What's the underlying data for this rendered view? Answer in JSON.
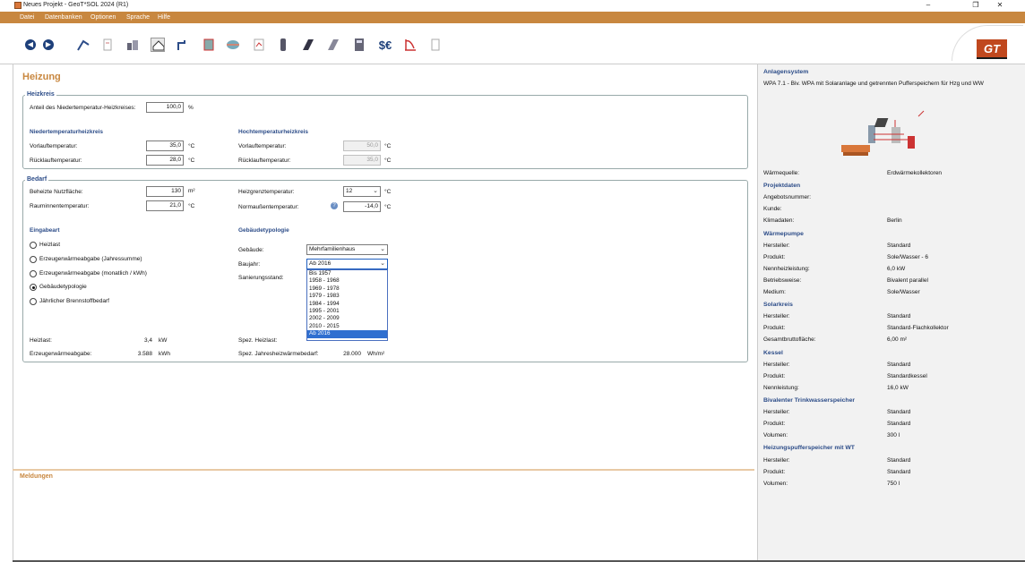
{
  "window": {
    "title": "Neues Projekt - GeoT*SOL 2024 (R1)",
    "minimize": "–",
    "restore": "❐",
    "close": "✕"
  },
  "menu": [
    "Datei",
    "Datenbanken",
    "Optionen",
    "Sprache",
    "Hilfe"
  ],
  "toolbar": {
    "back": "◀",
    "forward": "▶",
    "logo": "GT"
  },
  "page": {
    "title": "Heizung"
  },
  "heizkreis": {
    "legend": "Heizkreis",
    "anteil_label": "Anteil des Niedertemperatur-Heizkreises:",
    "anteil_value": "100,0",
    "anteil_unit": "%",
    "nt_title": "Niedertemperaturheizkreis",
    "ht_title": "Hochtemperaturheizkreis",
    "vorlauf_label": "Vorlauftemperatur:",
    "ruecklauf_label": "Rücklauftemperatur:",
    "nt_vorlauf": "35,0",
    "nt_ruecklauf": "28,0",
    "ht_vorlauf": "50,0",
    "ht_ruecklauf": "35,0",
    "unit_c": "°C"
  },
  "bedarf": {
    "legend": "Bedarf",
    "flaeche_label": "Beheizte Nutzfläche:",
    "flaeche_value": "130",
    "flaeche_unit": "m²",
    "raum_label": "Rauminnentemperatur:",
    "raum_value": "21,0",
    "heizgrenz_label": "Heizgrenztemperatur:",
    "heizgrenz_value": "12",
    "norm_label": "Normaußentemperatur:",
    "norm_value": "-14,0",
    "unit_c": "°C",
    "eingabeart_title": "Eingabeart",
    "eingabeart_options": [
      {
        "label": "Heizlast",
        "selected": false
      },
      {
        "label": "Erzeugerwärmeabgabe (Jahressumme)",
        "selected": false
      },
      {
        "label": "Erzeugerwärmeabgabe (monatlich / kWh)",
        "selected": false
      },
      {
        "label": "Gebäudetypologie",
        "selected": true
      },
      {
        "label": "Jährlicher Brennstoffbedarf",
        "selected": false
      }
    ],
    "typologie_title": "Gebäudetypologie",
    "gebaeude_label": "Gebäude:",
    "gebaeude_value": "Mehrfamilienhaus",
    "baujahr_label": "Baujahr:",
    "baujahr_value": "Ab 2016",
    "sanierung_label": "Sanierungsstand:",
    "baujahr_options": [
      "Bis 1957",
      "1958 - 1968",
      "1969 - 1978",
      "1979 - 1983",
      "1984 - 1994",
      "1995 - 2001",
      "2002 - 2009",
      "2010 - 2015",
      "Ab 2016"
    ],
    "heizlast_label": "Heizlast:",
    "heizlast_value": "3,4",
    "heizlast_unit": "kW",
    "erzeuger_label": "Erzeugerwärmeabgabe:",
    "erzeuger_value": "3.588",
    "erzeuger_unit": "kWh",
    "spez_heizlast_label": "Spez. Heizlast:",
    "spez_jahres_label": "Spez. Jahresheizwärmebedarf:",
    "spez_jahres_value": "28.000",
    "spez_jahres_unit": "Wh/m²"
  },
  "messages": {
    "title": "Meldungen"
  },
  "side": {
    "anlage_title": "Anlagensystem",
    "anlage_desc": "WPA 7.1 - Biv. WPA mit Solaranlage und getrennten Pufferspeichern für Hzg und WW",
    "rows_top": [
      {
        "k": "Wärmequelle:",
        "v": "Erdwärmekollektoren"
      }
    ],
    "sections": [
      {
        "title": "Projektdaten",
        "rows": [
          {
            "k": "Angebotsnummer:",
            "v": ""
          },
          {
            "k": "Kunde:",
            "v": ""
          },
          {
            "k": "Klimadaten:",
            "v": "Berlin"
          }
        ]
      },
      {
        "title": "Wärmepumpe",
        "rows": [
          {
            "k": "Hersteller:",
            "v": "Standard"
          },
          {
            "k": "Produkt:",
            "v": "Sole/Wasser -  6"
          },
          {
            "k": "Nennheizleistung:",
            "v": "6,0 kW"
          },
          {
            "k": "Betriebsweise:",
            "v": "Bivalent parallel"
          },
          {
            "k": "Medium:",
            "v": "Sole/Wasser"
          }
        ]
      },
      {
        "title": "Solarkreis",
        "rows": [
          {
            "k": "Hersteller:",
            "v": "Standard"
          },
          {
            "k": "Produkt:",
            "v": "Standard-Flachkollektor"
          },
          {
            "k": "Gesamtbruttofläche:",
            "v": "6,00 m²"
          }
        ]
      },
      {
        "title": "Kessel",
        "rows": [
          {
            "k": "Hersteller:",
            "v": "Standard"
          },
          {
            "k": "Produkt:",
            "v": "Standardkessel"
          },
          {
            "k": "Nennleistung:",
            "v": "16,0 kW"
          }
        ]
      },
      {
        "title": "Bivalenter Trinkwasserspeicher",
        "rows": [
          {
            "k": "Hersteller:",
            "v": "Standard"
          },
          {
            "k": "Produkt:",
            "v": "Standard"
          },
          {
            "k": "Volumen:",
            "v": "300 l"
          }
        ]
      },
      {
        "title": "Heizungspufferspeicher mit WT",
        "rows": [
          {
            "k": "Hersteller:",
            "v": "Standard"
          },
          {
            "k": "Produkt:",
            "v": "Standard"
          },
          {
            "k": "Volumen:",
            "v": "750 l"
          }
        ]
      }
    ]
  }
}
